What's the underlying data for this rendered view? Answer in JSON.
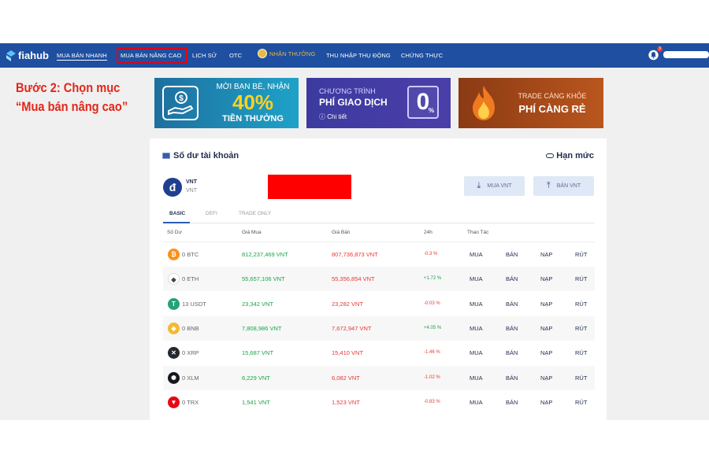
{
  "nav": {
    "logo": "fiahub",
    "items": [
      "MUA BÁN NHANH",
      "MUA BÁN NÂNG CAO",
      "LỊCH SỬ",
      "OTC",
      "NHẬN THƯỞNG",
      "THU NHẬP THỤ ĐỘNG",
      "CHỨNG THỰC"
    ],
    "notification_count": "3"
  },
  "step_note": {
    "line1": "Bước 2: Chọn mục",
    "line2": "“Mua bán nâng cao”"
  },
  "banners": {
    "b1": {
      "line1": "MỜI BẠN BÈ, NHẬN",
      "big": "40%",
      "line3": "TIỀN THƯỞNG"
    },
    "b2": {
      "line1": "CHƯƠNG TRÌNH",
      "line2": "PHÍ GIAO DỊCH",
      "line3": "Chi tiết",
      "big": "0",
      "unit": "%"
    },
    "b3": {
      "line1": "TRADE CÀNG KHỎE",
      "line2": "PHÍ CÀNG RẺ"
    }
  },
  "panel": {
    "title": "Số dư tài khoản",
    "limit": "Hạn mức",
    "currency_symbol": "đ",
    "currency_name": "VNT",
    "currency_sub": "VNT",
    "buy_button": "MUA VNT",
    "sell_button": "BÁN VNT",
    "tabs": [
      "BASIC",
      "DEFI",
      "TRADE ONLY"
    ],
    "headers": [
      "Số Dư",
      "Giá Mua",
      "Giá Bán",
      "24h",
      "Thao Tác"
    ],
    "actions": [
      "MUA",
      "BÁN",
      "NẠP",
      "RÚT"
    ]
  },
  "rows": [
    {
      "symbol": "BTC",
      "balance": "0 BTC",
      "buy": "812,237,469 VNT",
      "sell": "807,736,873 VNT",
      "change": "-0.3 %",
      "dir": "neg",
      "color": "#f7931a",
      "glyph": "₿"
    },
    {
      "symbol": "ETH",
      "balance": "0 ETH",
      "buy": "55,657,106 VNT",
      "sell": "55,356,854 VNT",
      "change": "+1.72 %",
      "dir": "pos",
      "color": "#ffffff",
      "glyph": "◆"
    },
    {
      "symbol": "USDT",
      "balance": "13 USDT",
      "buy": "23,342 VNT",
      "sell": "23,282 VNT",
      "change": "-0.03 %",
      "dir": "neg",
      "color": "#26a17b",
      "glyph": "T"
    },
    {
      "symbol": "BNB",
      "balance": "0 BNB",
      "buy": "7,808,986 VNT",
      "sell": "7,672,947 VNT",
      "change": "+4.05 %",
      "dir": "pos",
      "color": "#f3ba2f",
      "glyph": "◈"
    },
    {
      "symbol": "XRP",
      "balance": "0 XRP",
      "buy": "15,687 VNT",
      "sell": "15,410 VNT",
      "change": "-1.46 %",
      "dir": "neg",
      "color": "#23292f",
      "glyph": "✕"
    },
    {
      "symbol": "XLM",
      "balance": "0 XLM",
      "buy": "6,229 VNT",
      "sell": "6,082 VNT",
      "change": "-1.02 %",
      "dir": "neg",
      "color": "#14181c",
      "glyph": "✺"
    },
    {
      "symbol": "TRX",
      "balance": "0 TRX",
      "buy": "1,541 VNT",
      "sell": "1,523 VNT",
      "change": "-0.83 %",
      "dir": "neg",
      "color": "#e50914",
      "glyph": "▼"
    }
  ]
}
